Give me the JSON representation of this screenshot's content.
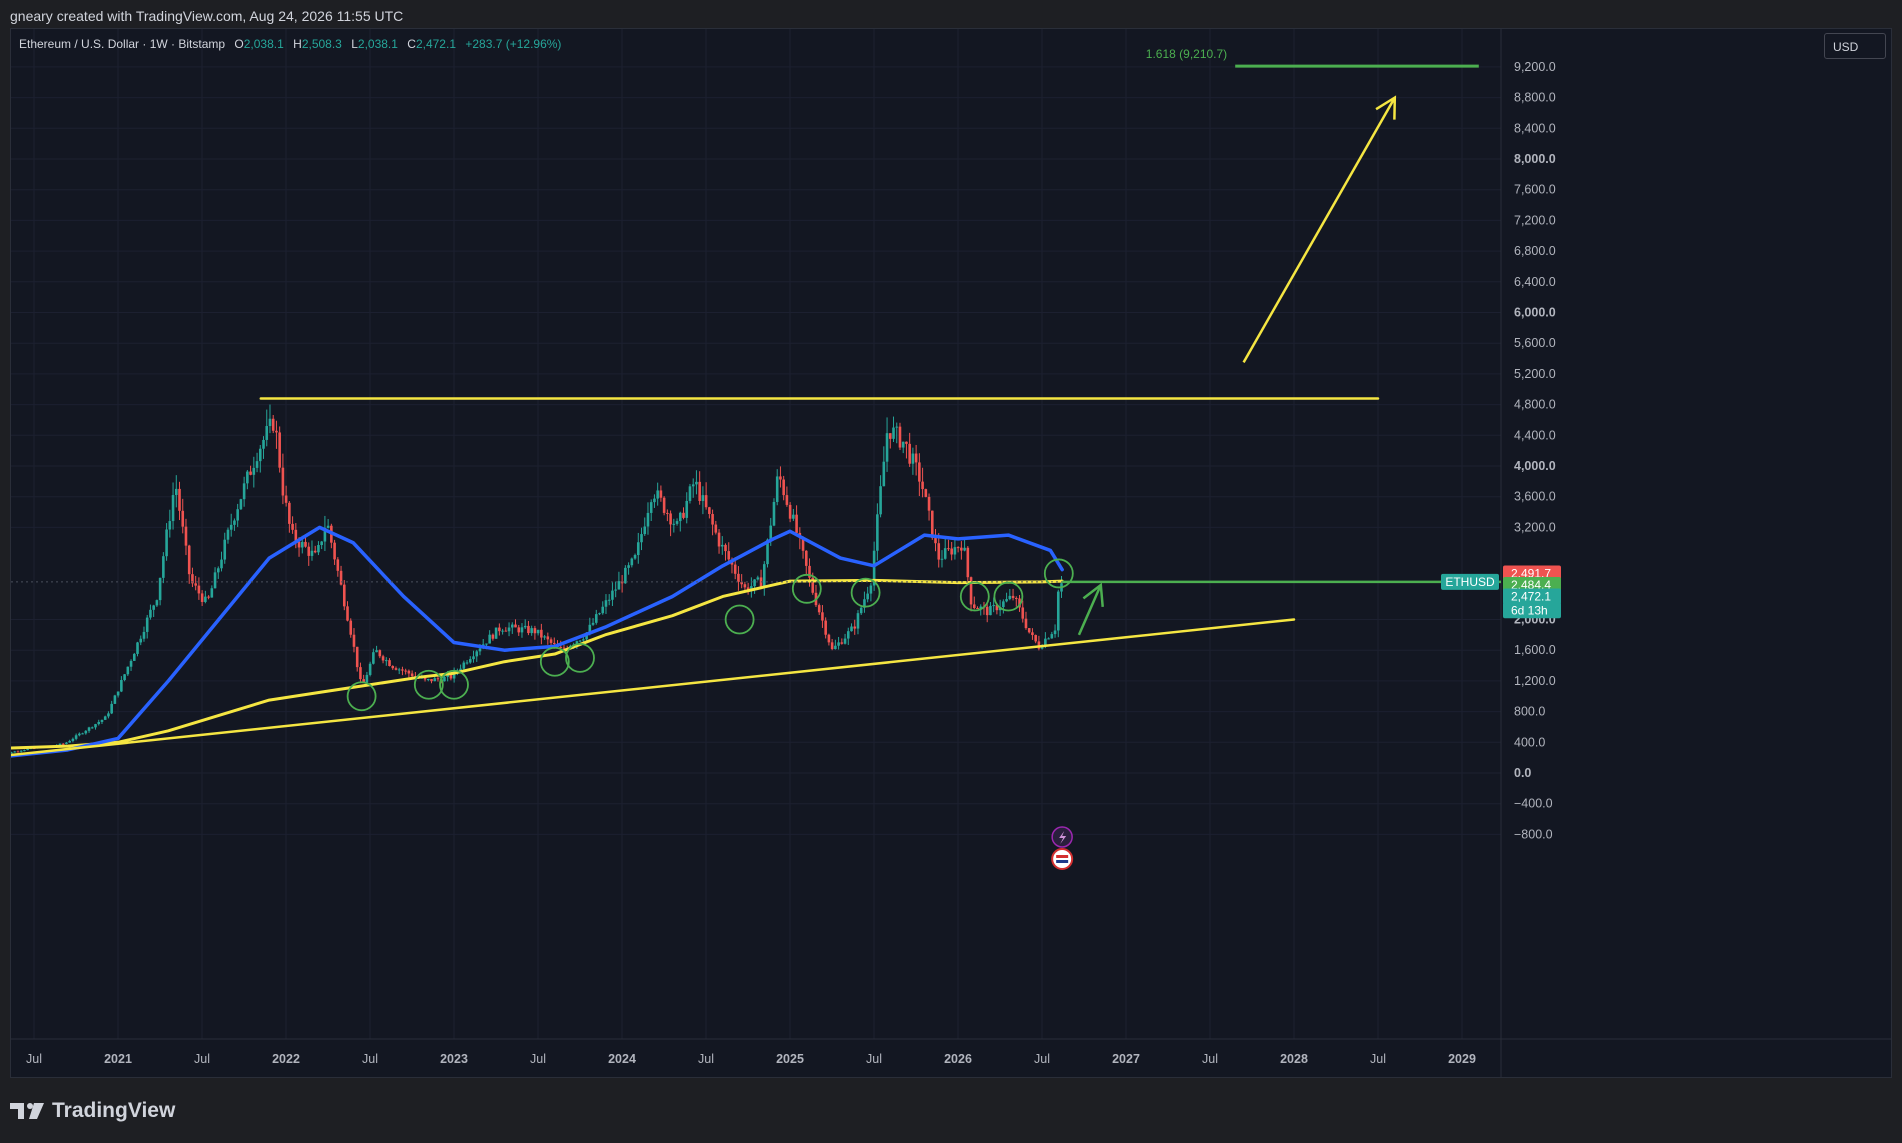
{
  "header": {
    "attribution": "gneary created with TradingView.com, Aug 24, 2026 11:55 UTC"
  },
  "legend": {
    "symbol": "Ethereum / U.S. Dollar · 1W · Bitstamp",
    "o_label": "O",
    "o_value": "2,038.1",
    "h_label": "H",
    "h_value": "2,508.3",
    "l_label": "L",
    "l_value": "2,038.1",
    "c_label": "C",
    "c_value": "2,472.1",
    "change": "+283.7 (+12.96%)"
  },
  "currency_button": "USD",
  "footer": {
    "brand": "TradingView"
  },
  "colors": {
    "up": "#26a69a",
    "down": "#ef5350",
    "sma_fast": "#2962ff",
    "sma_slow": "#f5e642",
    "fib": "#4caf50"
  },
  "chart_data": {
    "type": "candlestick",
    "title": "Ethereum / U.S. Dollar · 1W · Bitstamp",
    "ylim": [
      -1050,
      9600
    ],
    "y_ticks": [
      "9,200.0",
      "8,800.0",
      "8,400.0",
      "8,000.0",
      "7,600.0",
      "7,200.0",
      "6,800.0",
      "6,400.0",
      "6,000.0",
      "5,600.0",
      "5,200.0",
      "4,800.0",
      "4,400.0",
      "4,000.0",
      "3,600.0",
      "3,200.0",
      "2,000.0",
      "1,600.0",
      "1,200.0",
      "800.0",
      "400.0",
      "0.0",
      "−400.0",
      "−800.0"
    ],
    "y_tick_values": [
      9200,
      8800,
      8400,
      8000,
      7600,
      7200,
      6800,
      6400,
      6000,
      5600,
      5200,
      4800,
      4400,
      4000,
      3600,
      3200,
      2000,
      1600,
      1200,
      800,
      400,
      0,
      -400,
      -800
    ],
    "bold_ticks": [
      "8,000.0",
      "6,000.0",
      "4,000.0",
      "2,000.0",
      "0.0"
    ],
    "x_ticks": [
      {
        "label": "Jul",
        "t": 2020.5
      },
      {
        "label": "2021",
        "t": 2021.0
      },
      {
        "label": "Jul",
        "t": 2021.5
      },
      {
        "label": "2022",
        "t": 2022.0
      },
      {
        "label": "Jul",
        "t": 2022.5
      },
      {
        "label": "2023",
        "t": 2023.0
      },
      {
        "label": "Jul",
        "t": 2023.5
      },
      {
        "label": "2024",
        "t": 2024.0
      },
      {
        "label": "Jul",
        "t": 2024.5
      },
      {
        "label": "2025",
        "t": 2025.0
      },
      {
        "label": "Jul",
        "t": 2025.5
      },
      {
        "label": "2026",
        "t": 2026.0
      },
      {
        "label": "Jul",
        "t": 2026.5
      },
      {
        "label": "2027",
        "t": 2027.0
      },
      {
        "label": "Jul",
        "t": 2027.5
      },
      {
        "label": "2028",
        "t": 2028.0
      },
      {
        "label": "Jul",
        "t": 2028.5
      },
      {
        "label": "2029",
        "t": 2029.0
      }
    ],
    "price_keypoints": [
      [
        2020.27,
        220
      ],
      [
        2020.45,
        300
      ],
      [
        2020.7,
        380
      ],
      [
        2020.95,
        730
      ],
      [
        2021.1,
        1500
      ],
      [
        2021.25,
        2300
      ],
      [
        2021.36,
        3800
      ],
      [
        2021.45,
        2500
      ],
      [
        2021.55,
        2200
      ],
      [
        2021.7,
        3300
      ],
      [
        2021.85,
        4200
      ],
      [
        2021.95,
        4600
      ],
      [
        2022.0,
        3700
      ],
      [
        2022.05,
        3100
      ],
      [
        2022.2,
        2800
      ],
      [
        2022.26,
        3300
      ],
      [
        2022.4,
        1900
      ],
      [
        2022.47,
        1100
      ],
      [
        2022.55,
        1600
      ],
      [
        2022.65,
        1400
      ],
      [
        2022.85,
        1200
      ],
      [
        2023.0,
        1250
      ],
      [
        2023.15,
        1600
      ],
      [
        2023.3,
        1900
      ],
      [
        2023.5,
        1850
      ],
      [
        2023.65,
        1600
      ],
      [
        2023.8,
        1800
      ],
      [
        2023.95,
        2300
      ],
      [
        2024.1,
        2800
      ],
      [
        2024.2,
        3700
      ],
      [
        2024.35,
        3200
      ],
      [
        2024.45,
        3800
      ],
      [
        2024.6,
        3000
      ],
      [
        2024.75,
        2400
      ],
      [
        2024.85,
        2500
      ],
      [
        2024.95,
        3900
      ],
      [
        2025.05,
        3200
      ],
      [
        2025.15,
        2400
      ],
      [
        2025.27,
        1600
      ],
      [
        2025.4,
        1900
      ],
      [
        2025.5,
        2500
      ],
      [
        2025.6,
        4500
      ],
      [
        2025.7,
        4300
      ],
      [
        2025.8,
        3800
      ],
      [
        2025.9,
        2800
      ],
      [
        2026.05,
        3000
      ],
      [
        2026.1,
        2200
      ],
      [
        2026.2,
        2100
      ],
      [
        2026.35,
        2300
      ],
      [
        2026.45,
        1800
      ],
      [
        2026.5,
        1650
      ],
      [
        2026.6,
        1900
      ],
      [
        2026.62,
        2472.1
      ]
    ],
    "sma_fast": [
      [
        2020.0,
        140
      ],
      [
        2020.7,
        300
      ],
      [
        2021.0,
        450
      ],
      [
        2021.3,
        1200
      ],
      [
        2021.6,
        2000
      ],
      [
        2021.9,
        2800
      ],
      [
        2022.2,
        3200
      ],
      [
        2022.4,
        3000
      ],
      [
        2022.7,
        2300
      ],
      [
        2023.0,
        1700
      ],
      [
        2023.3,
        1600
      ],
      [
        2023.6,
        1650
      ],
      [
        2023.9,
        1900
      ],
      [
        2024.3,
        2300
      ],
      [
        2024.6,
        2700
      ],
      [
        2024.9,
        3050
      ],
      [
        2025.0,
        3150
      ],
      [
        2025.3,
        2800
      ],
      [
        2025.5,
        2700
      ],
      [
        2025.8,
        3100
      ],
      [
        2026.0,
        3050
      ],
      [
        2026.3,
        3100
      ],
      [
        2026.55,
        2900
      ],
      [
        2026.62,
        2650
      ]
    ],
    "sma_slow": [
      [
        2020.0,
        300
      ],
      [
        2020.7,
        350
      ],
      [
        2021.0,
        400
      ],
      [
        2021.3,
        550
      ],
      [
        2021.6,
        750
      ],
      [
        2021.9,
        950
      ],
      [
        2022.2,
        1050
      ],
      [
        2022.5,
        1150
      ],
      [
        2022.8,
        1250
      ],
      [
        2023.0,
        1300
      ],
      [
        2023.3,
        1450
      ],
      [
        2023.6,
        1550
      ],
      [
        2023.9,
        1800
      ],
      [
        2024.3,
        2050
      ],
      [
        2024.6,
        2300
      ],
      [
        2024.9,
        2450
      ],
      [
        2025.0,
        2500
      ],
      [
        2025.5,
        2510
      ],
      [
        2026.0,
        2480
      ],
      [
        2026.5,
        2490
      ],
      [
        2026.62,
        2500
      ]
    ],
    "support_line": [
      [
        2020.0,
        150
      ],
      [
        2028.0,
        2000
      ]
    ],
    "resistance_line": [
      [
        2021.85,
        4880
      ],
      [
        2028.5,
        4880
      ]
    ],
    "fib_line": {
      "label": "1.618 (9,210.7)",
      "x": [
        2027.65,
        2029.1
      ],
      "y": 9210.7
    },
    "current_price_line": {
      "x": [
        2026.62,
        2029.12
      ],
      "y": 2490
    },
    "projection_arrow": [
      [
        2027.7,
        5350
      ],
      [
        2028.6,
        8800
      ]
    ],
    "green_arrow": [
      [
        2026.72,
        1800
      ],
      [
        2026.85,
        2450
      ]
    ],
    "circles": [
      [
        2022.45,
        1000
      ],
      [
        2022.85,
        1150
      ],
      [
        2023.0,
        1150
      ],
      [
        2023.6,
        1450
      ],
      [
        2023.75,
        1500
      ],
      [
        2024.7,
        2000
      ],
      [
        2025.1,
        2400
      ],
      [
        2025.45,
        2350
      ],
      [
        2026.1,
        2300
      ],
      [
        2026.3,
        2300
      ],
      [
        2026.6,
        2600
      ]
    ],
    "price_labels": [
      {
        "text": "2,491.7",
        "y": 2600,
        "color": "#ef5350"
      },
      {
        "text": "2,484.4",
        "y": 2450,
        "color": "#4caf50"
      },
      {
        "text": "2,472.1",
        "y": 2300,
        "color": "#26a69a"
      },
      {
        "text": "6d 13h",
        "y": 2120,
        "color": "#26a69a"
      }
    ],
    "symbol_tag": "ETHUSD"
  }
}
